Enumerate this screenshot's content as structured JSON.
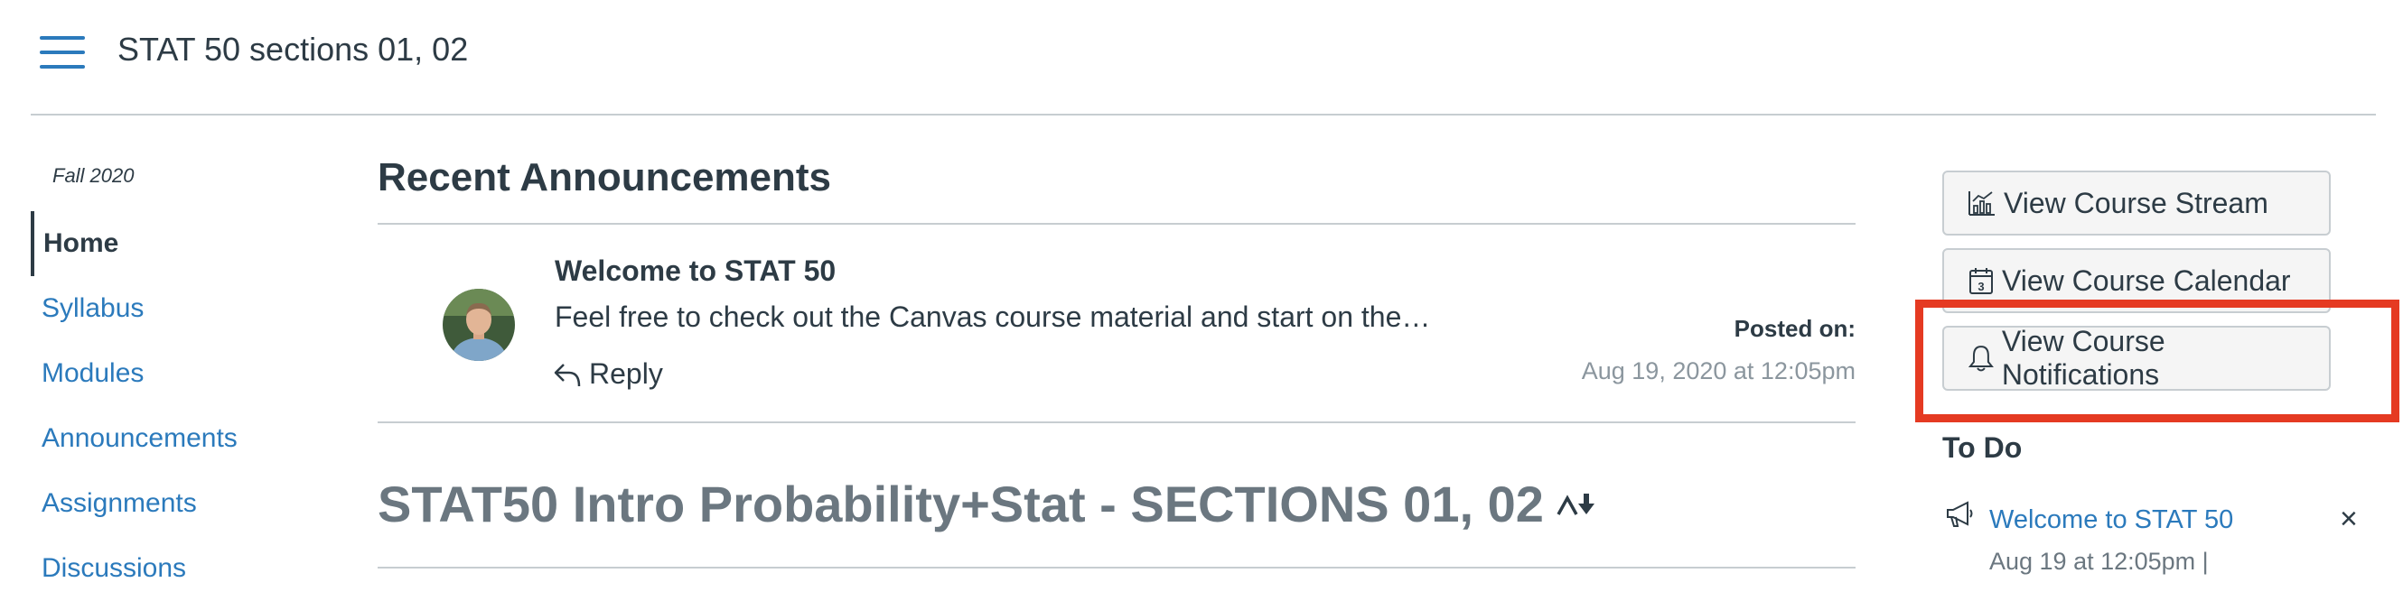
{
  "header": {
    "breadcrumb": "STAT 50 sections 01, 02"
  },
  "sidebar": {
    "term": "Fall 2020",
    "items": [
      {
        "label": "Home",
        "active": true
      },
      {
        "label": "Syllabus"
      },
      {
        "label": "Modules"
      },
      {
        "label": "Announcements"
      },
      {
        "label": "Assignments"
      },
      {
        "label": "Discussions"
      }
    ]
  },
  "main": {
    "section_title": "Recent Announcements",
    "announcement": {
      "title": "Welcome to STAT 50",
      "snippet": "Feel free to check out the Canvas course material and start on the…",
      "reply_label": "Reply",
      "posted_label": "Posted on:",
      "posted_date": "Aug 19, 2020 at 12:05pm"
    },
    "course_title": "STAT50 Intro Probability+Stat - SECTIONS 01, 02"
  },
  "right_sidebar": {
    "buttons": [
      {
        "label": "View Course Stream",
        "icon": "stream-chart-icon"
      },
      {
        "label": "View Course Calendar",
        "icon": "calendar-icon"
      },
      {
        "label": "View Course Notifications",
        "icon": "bell-icon"
      }
    ],
    "todo": {
      "title": "To Do",
      "item_title": "Welcome to STAT 50",
      "item_meta": "Aug 19 at 12:05pm  |",
      "icon": "megaphone-icon",
      "dismiss": "×"
    }
  },
  "colors": {
    "link": "#2b7abc",
    "text": "#2d3b45",
    "muted": "#6b7780",
    "highlight": "#e53a22"
  }
}
